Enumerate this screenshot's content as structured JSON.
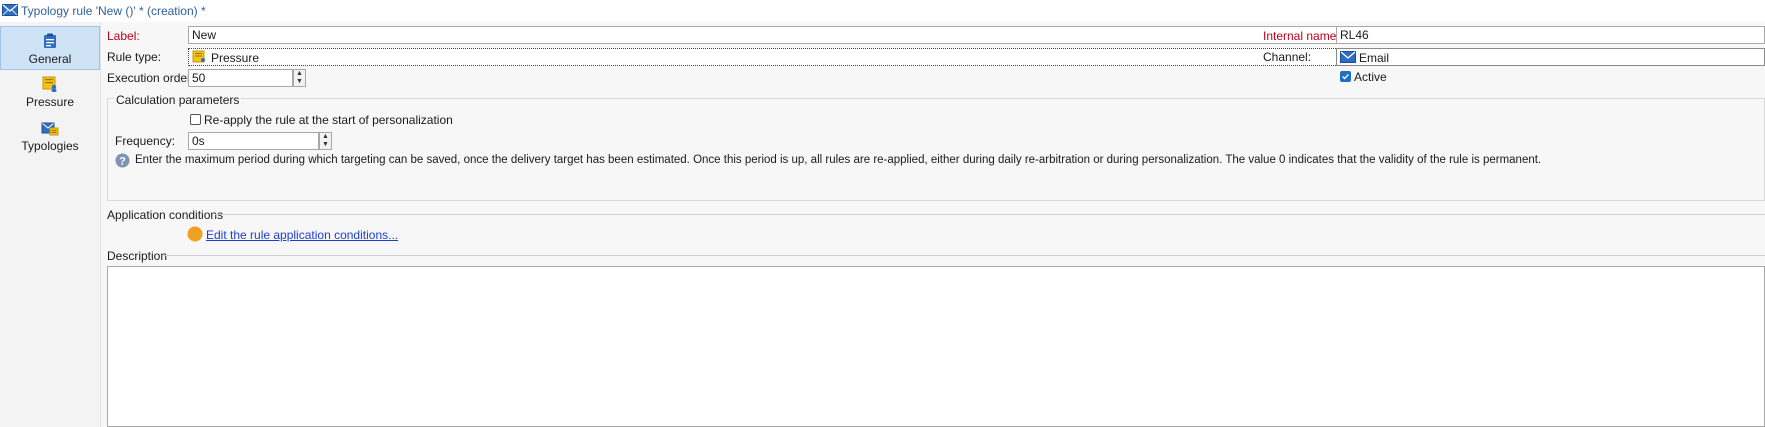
{
  "window": {
    "title": "Typology rule 'New ()' * (creation) *"
  },
  "sidebar": {
    "items": [
      {
        "label": "General",
        "icon": "clipboard-icon",
        "selected": true
      },
      {
        "label": "Pressure",
        "icon": "pressure-icon",
        "selected": false
      },
      {
        "label": "Typologies",
        "icon": "typologies-icon",
        "selected": false
      }
    ]
  },
  "form": {
    "label_caption": "Label:",
    "label_value": "New",
    "rule_type_caption": "Rule type:",
    "rule_type_value": "Pressure",
    "execution_order_caption": "Execution order:",
    "execution_order_value": "50",
    "internal_name_caption": "Internal name:",
    "internal_name_value": "RL46",
    "channel_caption": "Channel:",
    "channel_value": "Email",
    "active_label": "Active",
    "active_checked": true
  },
  "calculation": {
    "group_title": "Calculation parameters",
    "reapply_label": "Re-apply the rule at the start of personalization",
    "reapply_checked": false,
    "frequency_caption": "Frequency:",
    "frequency_value": "0s",
    "help_text": "Enter the maximum period during which targeting can be saved, once the delivery target has been estimated. Once this period is up, all rules are re-applied, either during daily re-arbitration or during personalization. The value 0 indicates that the validity of the rule is permanent."
  },
  "application_conditions": {
    "title": "Application conditions",
    "link_text": "Edit the rule application conditions..."
  },
  "description": {
    "title": "Description",
    "value": ""
  },
  "colors": {
    "required_label": "#c0001c",
    "link": "#1c3fd0",
    "selected_nav": "#cfe3f7",
    "status_dot": "#f0a020"
  }
}
